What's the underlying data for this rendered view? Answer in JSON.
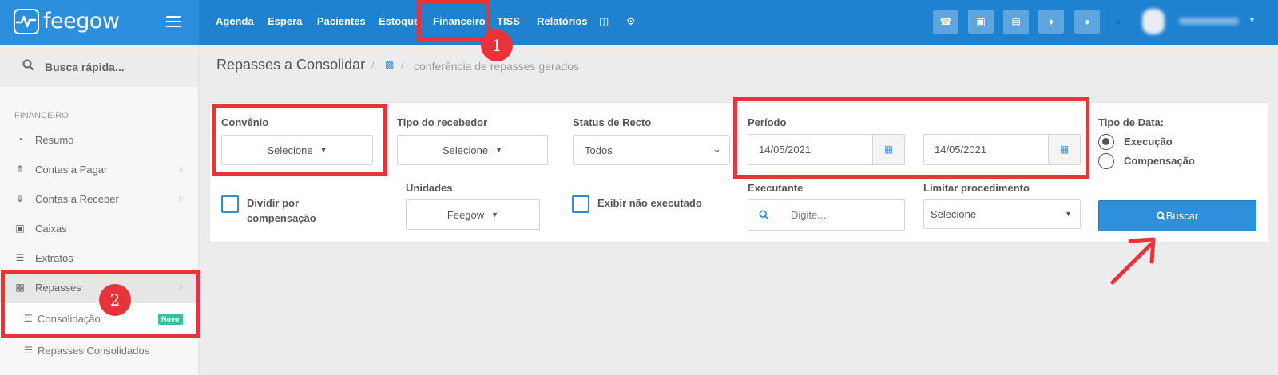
{
  "brand": {
    "name": "feegow"
  },
  "topnav": {
    "items": [
      "Agenda",
      "Espera",
      "Pacientes",
      "Estoque",
      "Financeiro",
      "TISS",
      "Relatórios"
    ],
    "active": "Financeiro",
    "icon_items": [
      "database-icon",
      "gear-icon"
    ],
    "buttons": [
      "phone-icon",
      "inbox-icon",
      "card-icon",
      "bell-icon",
      "chat-icon"
    ]
  },
  "sidebar": {
    "search_label": "Busca rápida...",
    "section_title": "FINANCEIRO",
    "items": [
      {
        "label": "Resumo",
        "icon": "pie-chart-icon",
        "chevron": false
      },
      {
        "label": "Contas a Pagar",
        "icon": "arrow-up-circle-icon",
        "chevron": true
      },
      {
        "label": "Contas a Receber",
        "icon": "arrow-down-circle-icon",
        "chevron": true
      },
      {
        "label": "Caixas",
        "icon": "inbox-icon",
        "chevron": false
      },
      {
        "label": "Extratos",
        "icon": "list-icon",
        "chevron": false
      },
      {
        "label": "Repasses",
        "icon": "sitemap-icon",
        "chevron": true
      }
    ],
    "subitems": [
      {
        "label": "Consolidação",
        "badge": "Novo"
      },
      {
        "label": "Repasses Consolidados",
        "badge": ""
      }
    ]
  },
  "header": {
    "title": "Repasses a Consolidar",
    "crumb": "conferência de repasses gerados"
  },
  "filters": {
    "convenio": {
      "label": "Convênio",
      "value": "Selecione"
    },
    "tipo_recebedor": {
      "label": "Tipo do recebedor",
      "value": "Selecione"
    },
    "status_recto": {
      "label": "Status de Recto",
      "value": "Todos"
    },
    "periodo": {
      "label": "Período",
      "from": "14/05/2021",
      "to": "14/05/2021"
    },
    "tipo_data": {
      "label": "Tipo de Data:",
      "options": [
        "Execução",
        "Compensação"
      ],
      "selected": "Execução"
    },
    "dividir": {
      "label_line1": "Dividir por",
      "label_line2": "compensação",
      "checked": false
    },
    "unidades": {
      "label": "Unidades",
      "value": "Feegow"
    },
    "exibir": {
      "label": "Exibir não executado",
      "checked": false
    },
    "executante": {
      "label": "Executante",
      "placeholder": "Digite..."
    },
    "limitar": {
      "label": "Limitar procedimento",
      "value": "Selecione"
    },
    "buscar_label": "Buscar"
  },
  "annotations": {
    "step1": "1",
    "step2": "2",
    "highlight_color": "#e8333a"
  },
  "colors": {
    "primary": "#2c8fde",
    "topbar": "#1f82d0",
    "badge": "#3bbe9a"
  }
}
